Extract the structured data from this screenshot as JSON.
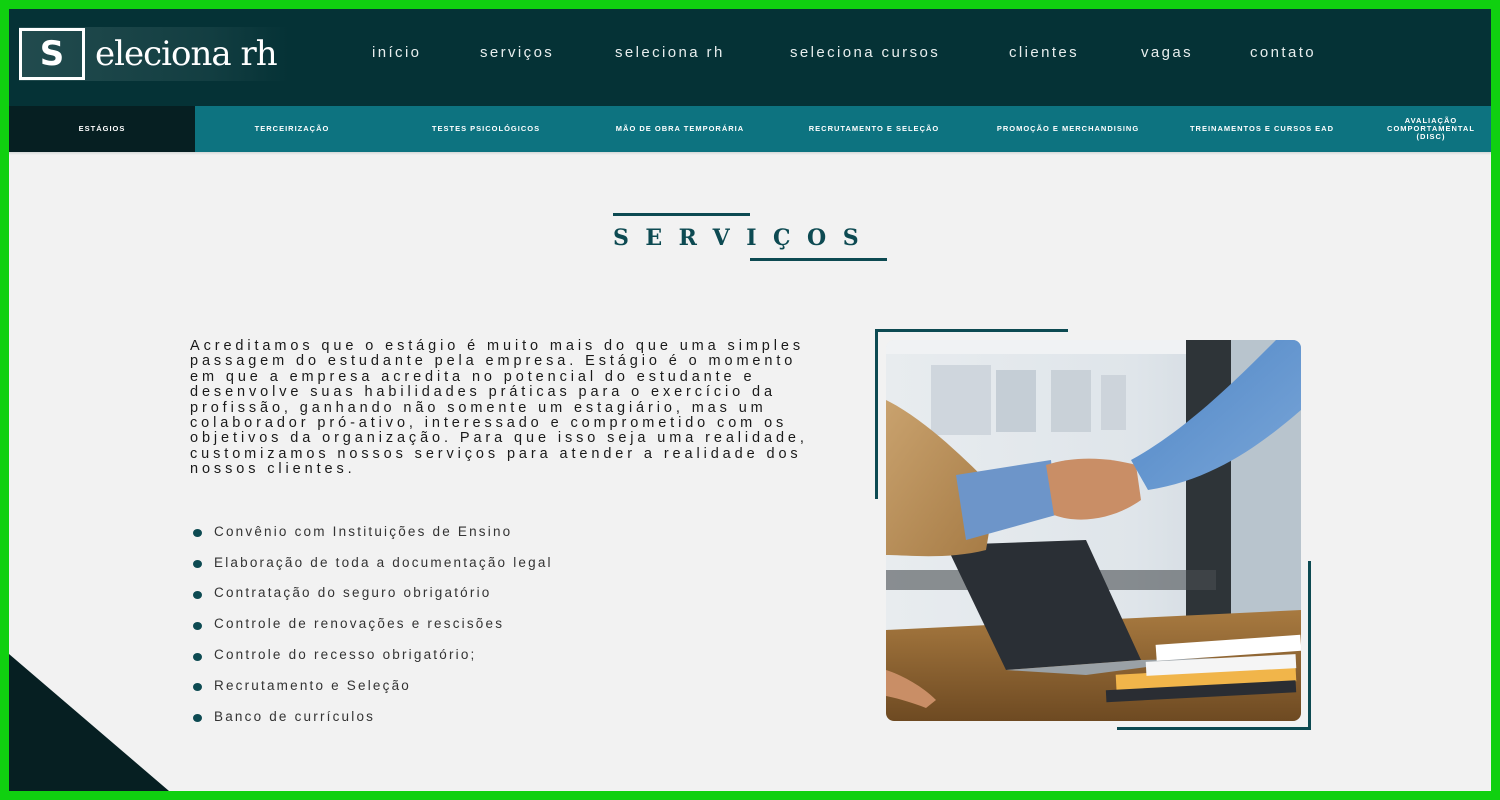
{
  "brand": {
    "logo_letter": "S",
    "logo_text": "eleciona rh",
    "primary_color": "#053236",
    "accent_color": "#0d7380",
    "dark_color": "#061f22"
  },
  "nav": {
    "items": [
      {
        "label": "início"
      },
      {
        "label": "serviços"
      },
      {
        "label": "seleciona rh"
      },
      {
        "label": "seleciona cursos"
      },
      {
        "label": "clientes"
      },
      {
        "label": "vagas"
      },
      {
        "label": "contato"
      }
    ]
  },
  "subnav": {
    "items": [
      {
        "label": "ESTÁGIOS",
        "active": true
      },
      {
        "label": "TERCEIRIZAÇÃO"
      },
      {
        "label": "TESTES PSICOLÓGICOS"
      },
      {
        "label": "MÃO DE OBRA TEMPORÁRIA"
      },
      {
        "label": "RECRUTAMENTO E SELEÇÃO"
      },
      {
        "label": "PROMOÇÃO E MERCHANDISING"
      },
      {
        "label": "TREINAMENTOS E CURSOS EAD"
      },
      {
        "label": "AVALIAÇÃO COMPORTAMENTAL (DISC)"
      }
    ]
  },
  "section": {
    "title": "SERVIÇOS",
    "intro": "Acreditamos que o estágio é muito mais do que uma simples passagem do estudante pela empresa. Estágio é o momento em que a empresa acredita no potencial do estudante e desenvolve suas habilidades práticas para o exercício da profissão, ganhando não somente um estagiário, mas um colaborador pró-ativo, interessado e comprometido com os objetivos da organização. Para que isso seja uma realidade, customizamos nossos serviços para atender a realidade dos nossos clientes.",
    "features": [
      "Convênio com Instituições de Ensino",
      "Elaboração de toda a documentação legal",
      "Contratação do seguro obrigatório",
      "Controle de renovações e rescisões",
      "Controle do recesso obrigatório;",
      "Recrutamento e Seleção",
      "Banco de currículos"
    ]
  }
}
